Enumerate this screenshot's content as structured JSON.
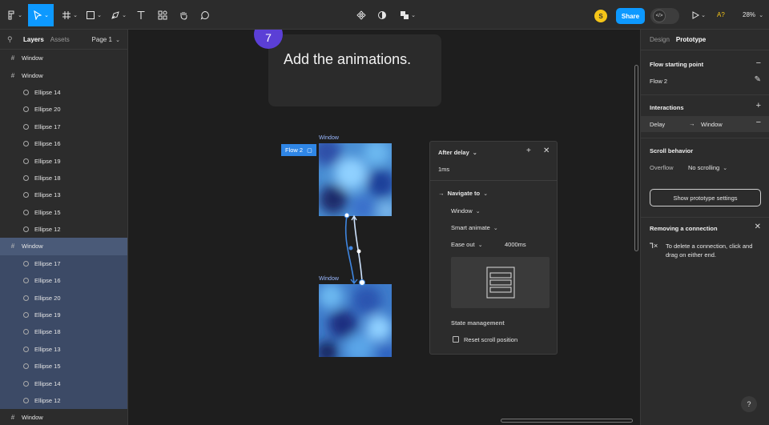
{
  "toolbar": {
    "avatar_initial": "S",
    "share_label": "Share",
    "ai_label": "A?",
    "zoom_label": "28%"
  },
  "layers_panel": {
    "tab_layers": "Layers",
    "tab_assets": "Assets",
    "page_label": "Page 1",
    "items": [
      {
        "kind": "frame",
        "name": "Window"
      },
      {
        "kind": "frame",
        "name": "Window"
      },
      {
        "kind": "ellipse",
        "name": "Ellipse 14"
      },
      {
        "kind": "ellipse",
        "name": "Ellipse 20"
      },
      {
        "kind": "ellipse",
        "name": "Ellipse 17"
      },
      {
        "kind": "ellipse",
        "name": "Ellipse 16"
      },
      {
        "kind": "ellipse",
        "name": "Ellipse 19"
      },
      {
        "kind": "ellipse",
        "name": "Ellipse 18"
      },
      {
        "kind": "ellipse",
        "name": "Ellipse 13"
      },
      {
        "kind": "ellipse",
        "name": "Ellipse 15"
      },
      {
        "kind": "ellipse",
        "name": "Ellipse 12"
      },
      {
        "kind": "frame",
        "name": "Window",
        "selected": true
      },
      {
        "kind": "ellipse",
        "name": "Ellipse 17",
        "selected": true
      },
      {
        "kind": "ellipse",
        "name": "Ellipse 16",
        "selected": true
      },
      {
        "kind": "ellipse",
        "name": "Ellipse 20",
        "selected": true
      },
      {
        "kind": "ellipse",
        "name": "Ellipse 19",
        "selected": true
      },
      {
        "kind": "ellipse",
        "name": "Ellipse 18",
        "selected": true
      },
      {
        "kind": "ellipse",
        "name": "Ellipse 13",
        "selected": true
      },
      {
        "kind": "ellipse",
        "name": "Ellipse 15",
        "selected": true
      },
      {
        "kind": "ellipse",
        "name": "Ellipse 14",
        "selected": true
      },
      {
        "kind": "ellipse",
        "name": "Ellipse 12",
        "selected": true
      },
      {
        "kind": "frame",
        "name": "Window"
      }
    ]
  },
  "canvas": {
    "step_number": "7",
    "step_text": "Add the animations.",
    "frame_top_label": "Window",
    "frame_bottom_label": "Window",
    "flow_tag": "Flow 2"
  },
  "interaction_popup": {
    "trigger": "After delay",
    "delay_value": "1ms",
    "action": "Navigate to",
    "destination": "Window",
    "animation": "Smart animate",
    "easing": "Ease out",
    "duration": "4000ms",
    "state_heading": "State management",
    "reset_scroll_label": "Reset scroll position"
  },
  "right_panel": {
    "tab_design": "Design",
    "tab_prototype": "Prototype",
    "flow_heading": "Flow starting point",
    "flow_name": "Flow 2",
    "interactions_heading": "Interactions",
    "interaction_trigger": "Delay",
    "interaction_target": "Window",
    "scroll_heading": "Scroll behavior",
    "overflow_label": "Overflow",
    "overflow_value": "No scrolling",
    "proto_settings_label": "Show prototype settings",
    "remove_heading": "Removing a connection",
    "remove_text": "To delete a connection, click and drag on either end.",
    "help_label": "?"
  },
  "colors": {
    "accent": "#0d99ff",
    "selection": "#3c4a66",
    "step_badge": "#5b3fd6",
    "connector": "#3f86e0"
  }
}
